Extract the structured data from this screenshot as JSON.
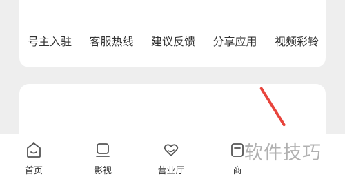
{
  "quick_links": [
    "号主入驻",
    "客服热线",
    "建议反馈",
    "分享应用",
    "视频彩铃"
  ],
  "bottom_nav": [
    {
      "label": "首页",
      "icon": "home-icon"
    },
    {
      "label": "影视",
      "icon": "tv-icon"
    },
    {
      "label": "营业厅",
      "icon": "heart-hand-icon"
    },
    {
      "label": "商",
      "icon": "shop-icon"
    }
  ],
  "watermark": "软件技巧",
  "colors": {
    "background": "#eeeeee",
    "card": "#ffffff",
    "text": "#333333",
    "annotation": "#e8443c",
    "watermark": "#a8a8a8"
  }
}
